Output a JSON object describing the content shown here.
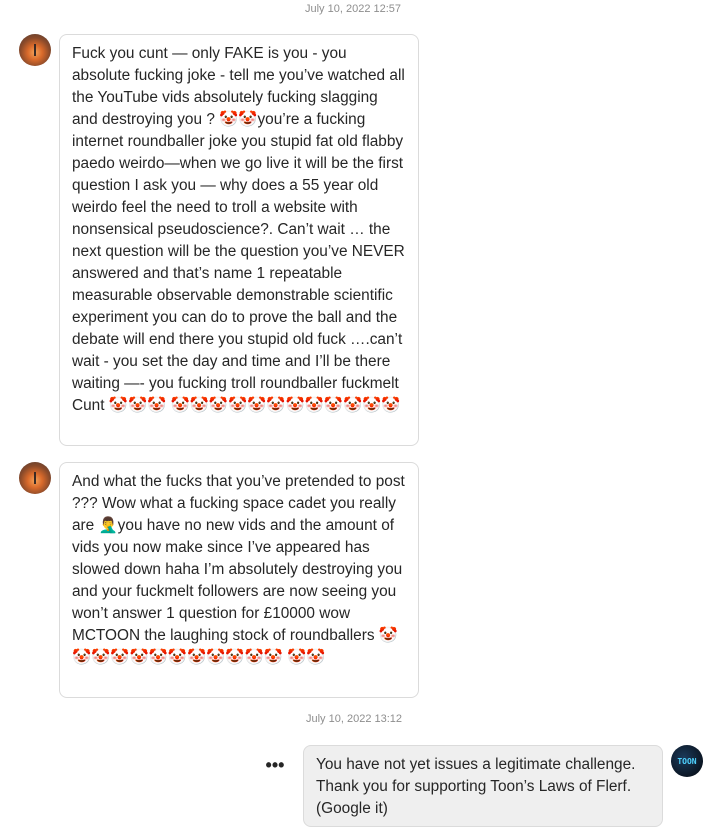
{
  "thread": {
    "timestamp_1": "July 10, 2022 12:57",
    "timestamp_2": "July 10, 2022 13:12",
    "messages": [
      {
        "sender": "other",
        "text": "Fuck  you cunt — only FAKE is you - you absolute fucking joke - tell me you’ve watched all the YouTube vids absolutely fucking slagging and destroying you ? 🤡🤡you’re a fucking internet roundballer joke you stupid fat old flabby paedo weirdo—when we go live it will be the first question I ask you — why does a 55 year old weirdo feel the need to troll a website with nonsensical pseudoscience?. Can’t wait … the next question will be the question you’ve NEVER answered and that’s name 1 repeatable measurable observable demonstrable scientific experiment you can do to prove the ball and the debate will end there you stupid old fuck ….can’t wait - you set the day and time and I’ll be there waiting —- you fucking troll roundballer fuckmelt Cunt 🤡🤡🤡 🤡🤡🤡🤡🤡🤡🤡🤡🤡🤡🤡🤡"
      },
      {
        "sender": "other",
        "text": "And what the fucks that you’ve pretended to post ??? Wow what a fucking space cadet you really are 🤦‍♂️you have no new vids and the amount of vids you now make since I’ve appeared has slowed down haha I’m absolutely destroying you and your fuckmelt followers are now seeing you won’t answer 1 question for £10000 wow MCTOON the laughing stock of roundballers 🤡🤡🤡🤡🤡🤡🤡🤡🤡🤡🤡🤡 🤡🤡"
      },
      {
        "sender": "me",
        "text": "You have not yet issues a legitimate challenge. Thank you for supporting Toon’s Laws of Flerf. (Google it)"
      }
    ],
    "more_options_label": "•••",
    "my_avatar_text": "TOON"
  }
}
